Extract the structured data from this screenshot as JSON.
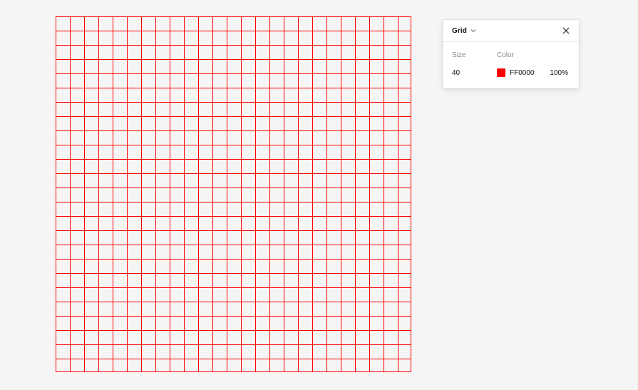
{
  "panel": {
    "title": "Grid",
    "labels": {
      "size": "Size",
      "color": "Color"
    },
    "values": {
      "size": "40",
      "hex": "FF0000",
      "opacity": "100%"
    }
  },
  "colors": {
    "background": "#f5f5f5",
    "grid_line": "#ff0000",
    "swatch": "#ff0000"
  },
  "icons": {
    "dropdown": "chevron-down-icon",
    "close": "close-icon"
  }
}
